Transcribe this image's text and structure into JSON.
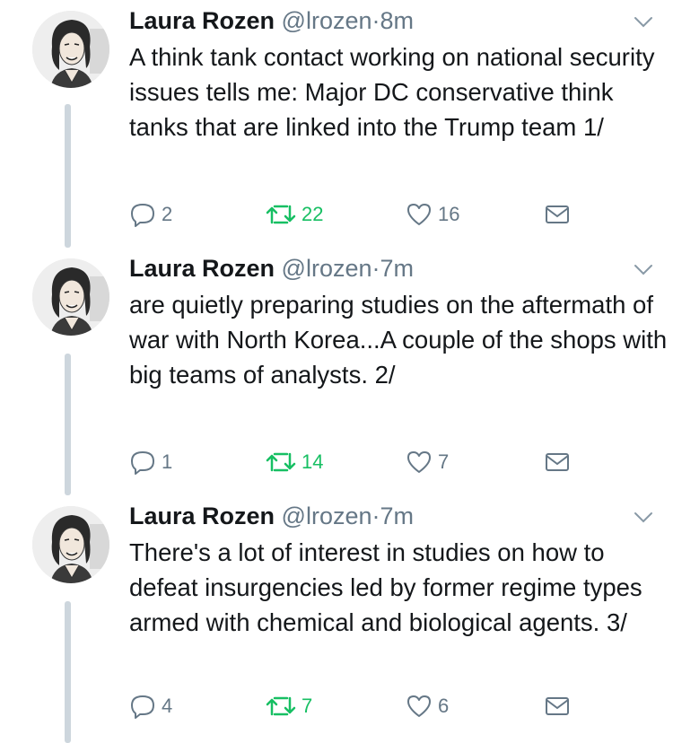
{
  "tweets": [
    {
      "name": "Laura Rozen",
      "handle": "@lrozen",
      "separator": "·",
      "time": "8m",
      "text": "A think tank contact working on national security issues tells me: Major DC conservative think tanks that are linked into the Trump team 1/",
      "replies": "2",
      "retweets": "22",
      "likes": "16"
    },
    {
      "name": "Laura Rozen",
      "handle": "@lrozen",
      "separator": "·",
      "time": "7m",
      "text": "are quietly preparing studies on the aftermath of war with North Korea...A couple of the shops with big teams of analysts. 2/",
      "replies": "1",
      "retweets": "14",
      "likes": "7"
    },
    {
      "name": "Laura Rozen",
      "handle": "@lrozen",
      "separator": "·",
      "time": "7m",
      "text": "There's a lot of interest in studies on how to defeat insurgencies led by former regime types armed with chemical and biological agents. 3/",
      "replies": "4",
      "retweets": "7",
      "likes": "6"
    }
  ],
  "colors": {
    "text": "#14171a",
    "secondary": "#657786",
    "retweet_active": "#17bf63",
    "thread_line": "#cdd6dd"
  },
  "icons": {
    "reply": "reply-icon",
    "retweet": "retweet-icon",
    "like": "heart-icon",
    "dm": "envelope-icon",
    "menu": "chevron-down-icon"
  }
}
